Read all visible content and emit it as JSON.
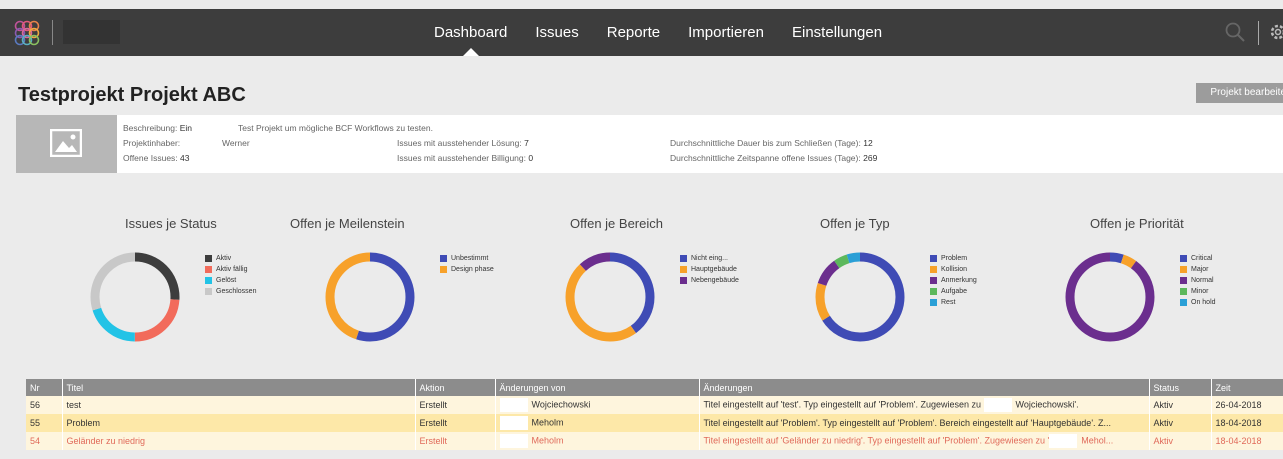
{
  "nav": {
    "items": [
      "Dashboard",
      "Issues",
      "Reporte",
      "Importieren",
      "Einstellungen"
    ],
    "active_index": 0
  },
  "project": {
    "title": "Testprojekt Projekt ABC",
    "edit_button": "Projekt bearbeiten",
    "info": {
      "beschreibung_label": "Beschreibung:",
      "beschreibung_toggle": "Ein",
      "beschreibung_value": "Test Projekt um mögliche BCF Workflows zu testen.",
      "inhaber_label": "Projektinhaber:",
      "inhaber_value": "Werner",
      "offene_label": "Offene Issues:",
      "offene_value": "43",
      "loesung_label": "Issues mit ausstehender Lösung:",
      "loesung_value": "7",
      "billigung_label": "Issues mit ausstehender Billigung:",
      "billigung_value": "0",
      "dauer_label": "Durchschnittliche Dauer bis zum Schließen (Tage):",
      "dauer_value": "12",
      "zeitspanne_label": "Durchschnittliche Zeitspanne offene Issues (Tage):",
      "zeitspanne_value": "269"
    }
  },
  "charts": [
    {
      "title": "Issues je Status",
      "legend": [
        {
          "label": "Aktiv",
          "color": "#3d3d3d"
        },
        {
          "label": "Aktiv fällig",
          "color": "#f26b5b"
        },
        {
          "label": "Gelöst",
          "color": "#22c3e6"
        },
        {
          "label": "Geschlossen",
          "color": "#c8c8c8"
        }
      ],
      "values": [
        26,
        24,
        20,
        30
      ]
    },
    {
      "title": "Offen je Meilenstein",
      "legend": [
        {
          "label": "Unbestimmt",
          "color": "#3f4bb5"
        },
        {
          "label": "Design phase",
          "color": "#f7a12a"
        }
      ],
      "values": [
        55,
        45
      ]
    },
    {
      "title": "Offen je Bereich",
      "legend": [
        {
          "label": "Nicht eing...",
          "color": "#3f4bb5"
        },
        {
          "label": "Hauptgebäude",
          "color": "#f7a12a"
        },
        {
          "label": "Nebengebäude",
          "color": "#6b2e8e"
        }
      ],
      "values": [
        40,
        48,
        12
      ]
    },
    {
      "title": "Offen je Typ",
      "legend": [
        {
          "label": "Problem",
          "color": "#3f4bb5"
        },
        {
          "label": "Kollision",
          "color": "#f7a12a"
        },
        {
          "label": "Anmerkung",
          "color": "#6b2e8e"
        },
        {
          "label": "Aufgabe",
          "color": "#5cb85c"
        },
        {
          "label": "Rest",
          "color": "#2a9fd6"
        }
      ],
      "values": [
        66,
        14,
        10,
        5,
        5
      ]
    },
    {
      "title": "Offen je Priorität",
      "legend": [
        {
          "label": "Critical",
          "color": "#3f4bb5"
        },
        {
          "label": "Major",
          "color": "#f7a12a"
        },
        {
          "label": "Normal",
          "color": "#6b2e8e"
        },
        {
          "label": "Minor",
          "color": "#5cb85c"
        },
        {
          "label": "On hold",
          "color": "#2a9fd6"
        }
      ],
      "values": [
        5,
        5,
        90,
        0,
        0
      ]
    }
  ],
  "table": {
    "headers": [
      "Nr",
      "Titel",
      "Aktion",
      "Änderungen von",
      "Änderungen",
      "Status",
      "Zeit"
    ],
    "rows": [
      {
        "nr": "56",
        "titel": "test",
        "aktion": "Erstellt",
        "von": "Wojciechowski",
        "aenderungen_a": "Titel eingestellt auf 'test'. Typ eingestellt auf 'Problem'. Zugewiesen zu",
        "aenderungen_b": "Wojciechowski'.",
        "status": "Aktiv",
        "zeit": "26-04-2018"
      },
      {
        "nr": "55",
        "titel": "Problem",
        "aktion": "Erstellt",
        "von": "Meholm",
        "aenderungen_a": "Titel eingestellt auf 'Problem'. Typ eingestellt auf 'Problem'. Bereich eingestellt auf 'Hauptgebäude'. Z...",
        "aenderungen_b": "",
        "status": "Aktiv",
        "zeit": "18-04-2018"
      },
      {
        "nr": "54",
        "titel": "Geländer zu niedrig",
        "aktion": "Erstellt",
        "von": "Meholm",
        "aenderungen_a": "Titel eingestellt auf 'Geländer zu niedrig'. Typ eingestellt auf 'Problem'. Zugewiesen zu '",
        "aenderungen_b": "Mehol...",
        "status": "Aktiv",
        "zeit": "18-04-2018"
      }
    ]
  }
}
